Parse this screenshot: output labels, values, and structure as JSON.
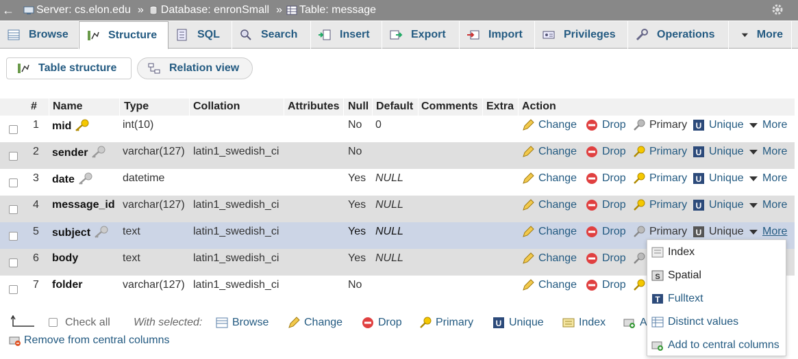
{
  "breadcrumb": {
    "back_arrow": "←",
    "server_label": "Server: cs.elon.edu",
    "sep1": "»",
    "database_label": "Database: enronSmall",
    "sep2": "»",
    "table_label": "Table: message"
  },
  "tabs": [
    {
      "label": "Browse",
      "icon": "browse-icon"
    },
    {
      "label": "Structure",
      "icon": "structure-icon"
    },
    {
      "label": "SQL",
      "icon": "sql-icon"
    },
    {
      "label": "Search",
      "icon": "search-icon"
    },
    {
      "label": "Insert",
      "icon": "insert-icon"
    },
    {
      "label": "Export",
      "icon": "export-icon"
    },
    {
      "label": "Import",
      "icon": "import-icon"
    },
    {
      "label": "Privileges",
      "icon": "privileges-icon"
    },
    {
      "label": "Operations",
      "icon": "operations-icon"
    },
    {
      "label": "More",
      "icon": "chevron-down-icon"
    }
  ],
  "subtabs": {
    "table_structure": "Table structure",
    "relation_view": "Relation view"
  },
  "table": {
    "headers": {
      "num": "#",
      "name": "Name",
      "type": "Type",
      "collation": "Collation",
      "attributes": "Attributes",
      "null": "Null",
      "default": "Default",
      "comments": "Comments",
      "extra": "Extra",
      "action": "Action"
    },
    "action_labels": {
      "change": "Change",
      "drop": "Drop",
      "primary": "Primary",
      "unique": "Unique",
      "more": "More"
    },
    "rows": [
      {
        "num": "1",
        "name": "mid",
        "type": "int(10)",
        "collation": "",
        "null": "No",
        "default": "0"
      },
      {
        "num": "2",
        "name": "sender",
        "type": "varchar(127)",
        "collation": "latin1_swedish_ci",
        "null": "No",
        "default": ""
      },
      {
        "num": "3",
        "name": "date",
        "type": "datetime",
        "collation": "",
        "null": "Yes",
        "default": "NULL"
      },
      {
        "num": "4",
        "name": "message_id",
        "type": "varchar(127)",
        "collation": "latin1_swedish_ci",
        "null": "Yes",
        "default": "NULL"
      },
      {
        "num": "5",
        "name": "subject",
        "type": "text",
        "collation": "latin1_swedish_ci",
        "null": "Yes",
        "default": "NULL"
      },
      {
        "num": "6",
        "name": "body",
        "type": "text",
        "collation": "latin1_swedish_ci",
        "null": "Yes",
        "default": "NULL"
      },
      {
        "num": "7",
        "name": "folder",
        "type": "varchar(127)",
        "collation": "latin1_swedish_ci",
        "null": "No",
        "default": ""
      }
    ]
  },
  "bottom": {
    "check_all": "Check all",
    "with_selected": "With selected:",
    "browse": "Browse",
    "change": "Change",
    "drop": "Drop",
    "primary": "Primary",
    "unique": "Unique",
    "index": "Index",
    "add_partial": "A",
    "remove_central": "Remove from central columns"
  },
  "more_menu": {
    "index": "Index",
    "spatial": "Spatial",
    "fulltext": "Fulltext",
    "distinct": "Distinct values",
    "add_central": "Add to central columns"
  },
  "colors": {
    "link": "#235a81",
    "selected_row": "#ccd5e6",
    "even_row": "#dfdfdf",
    "topbar": "#888888"
  }
}
